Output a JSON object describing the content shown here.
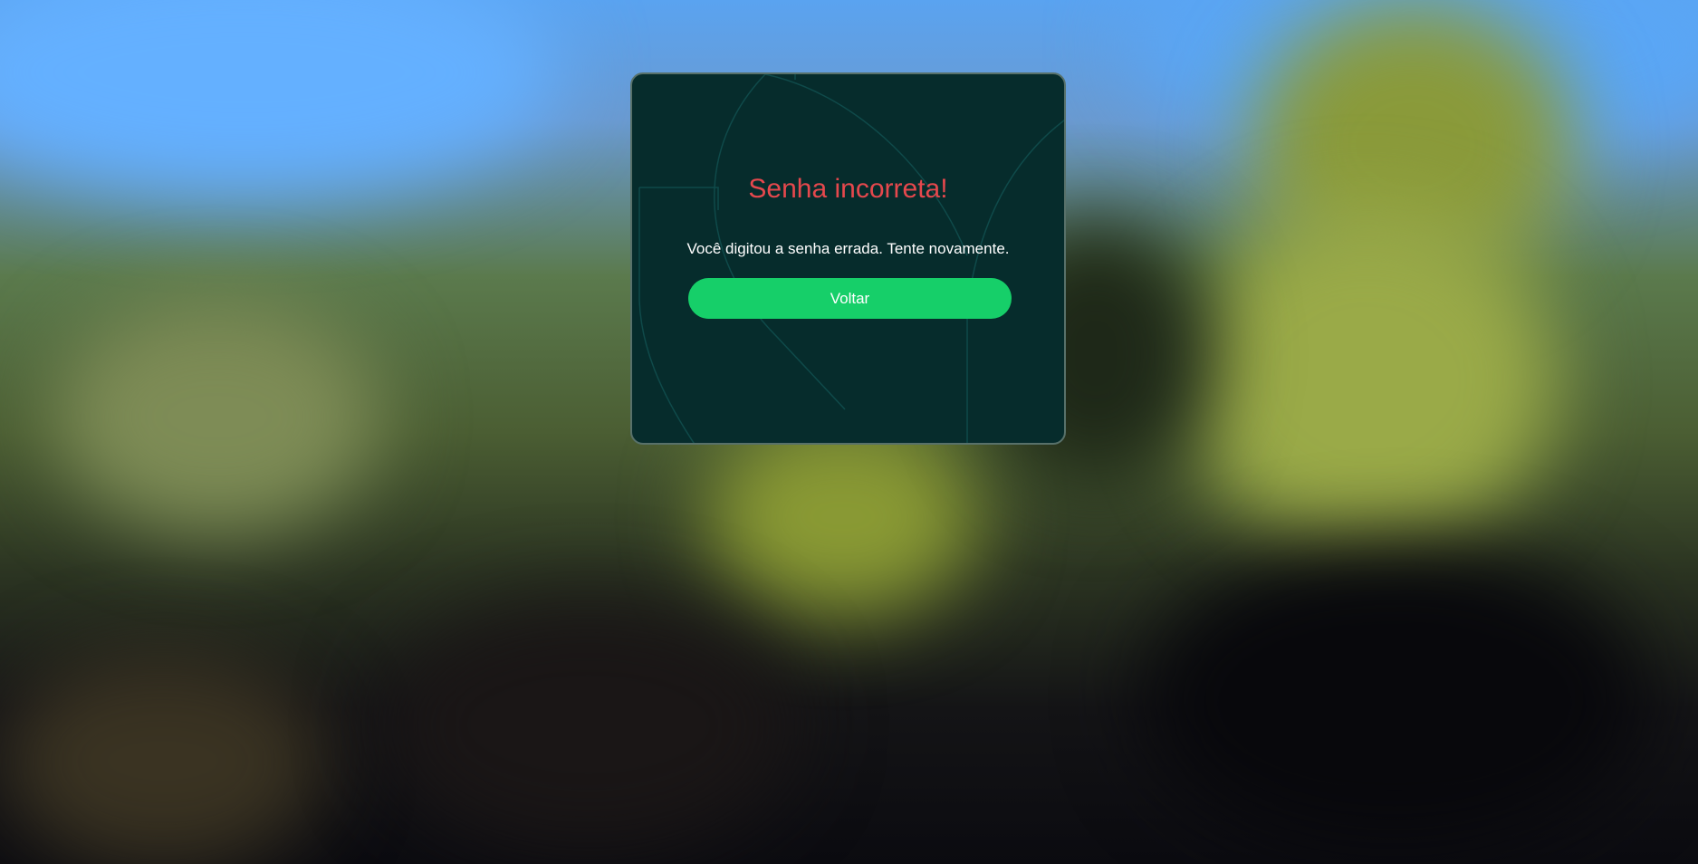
{
  "dialog": {
    "title": "Senha incorreta!",
    "message": "Você digitou a senha errada. Tente novamente.",
    "button_label": "Voltar"
  },
  "colors": {
    "card_background": "#062c2c",
    "title": "#e5484d",
    "button": "#16cf69"
  },
  "icons": {
    "card_decoration": "decorative-arcs"
  }
}
